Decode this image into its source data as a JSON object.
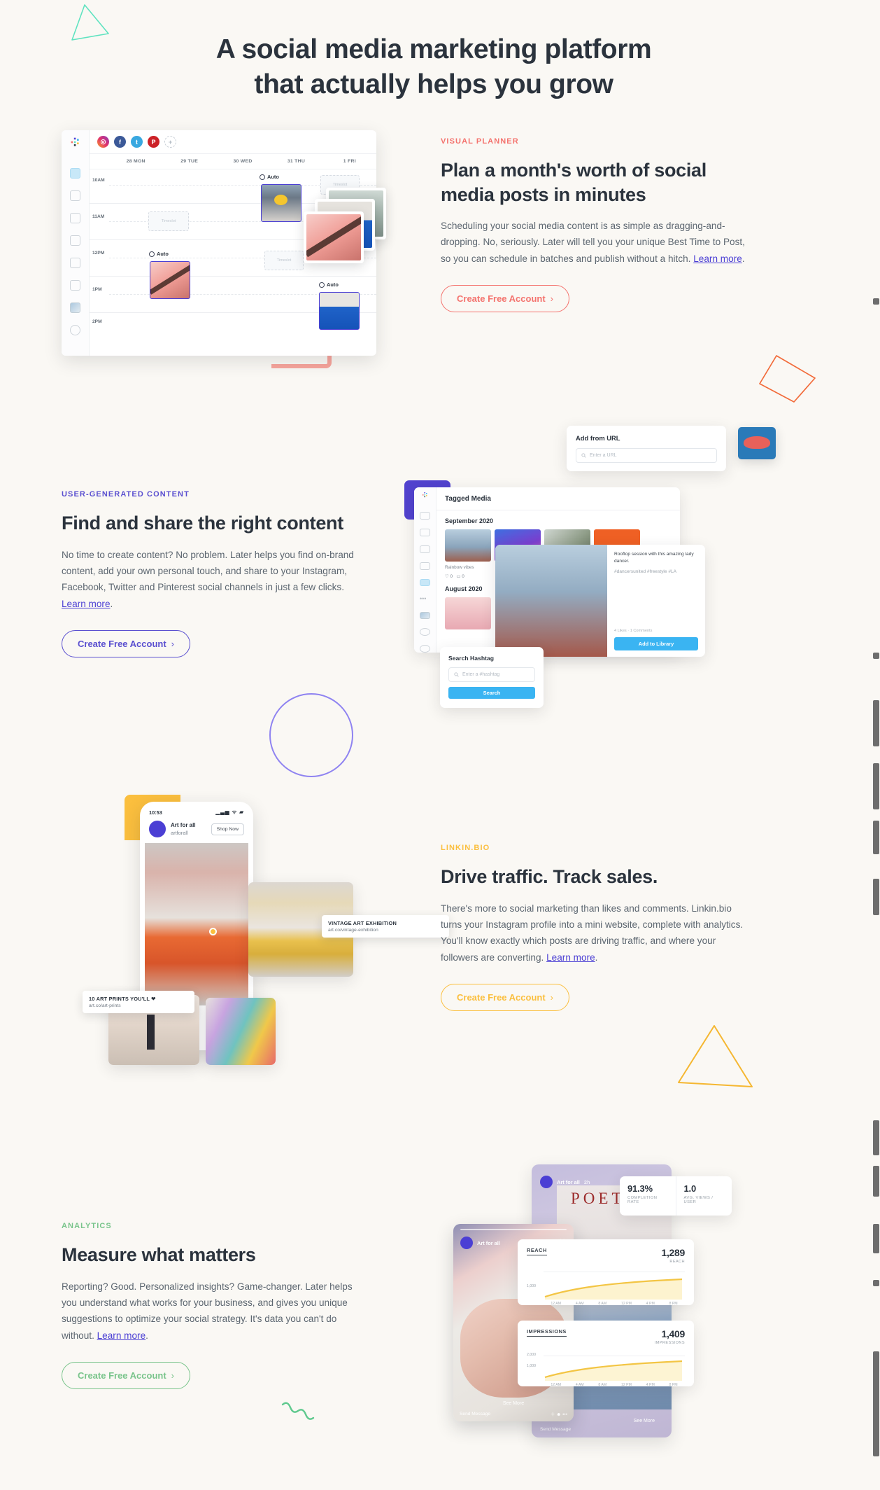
{
  "hero": {
    "line1": "A social media marketing platform",
    "line2": "that actually helps you grow"
  },
  "cta_label": "Create Free Account",
  "cta_chevron": "›",
  "learn_more": "Learn more",
  "colors": {
    "background": "#faf8f4",
    "heading": "#2b333d",
    "body_text": "#5c6670",
    "link": "#4b3fd4",
    "coral": "#f4736e",
    "purple": "#5a4fd0",
    "amber": "#fbbf3e",
    "green": "#79c48b",
    "blue_accent": "#3ab4f2"
  },
  "sections": [
    {
      "eyebrow": "VISUAL PLANNER",
      "heading": "Plan a month's worth of social media posts in minutes",
      "body_before": "Scheduling your social media content is as simple as dragging-and-dropping. No, seriously. Later will tell you your unique Best Time to Post, so you can schedule in batches and publish without a hitch. ",
      "body_after": ".",
      "accent": "coral"
    },
    {
      "eyebrow": "USER-GENERATED CONTENT",
      "heading": "Find and share the right content",
      "body_before": "No time to create content? No problem. Later helps you find on-brand content, add your own personal touch, and share to your Instagram, Facebook, Twitter and Pinterest social channels in just a few clicks. ",
      "body_after": ".",
      "accent": "purple"
    },
    {
      "eyebrow": "LINKIN.BIO",
      "heading": "Drive traffic. Track sales.",
      "body_before": "There's more to social marketing than likes and comments. Linkin.bio turns your Instagram profile into a mini website, complete with analytics. You'll know exactly which posts are driving traffic, and where your followers are converting. ",
      "body_after": ".",
      "accent": "amber"
    },
    {
      "eyebrow": "ANALYTICS",
      "heading": "Measure what matters",
      "body_before": "Reporting? Good. Personalized insights? Game-changer. Later helps you understand what works for your business, and gives you unique suggestions to optimize your social strategy. It's data you can't do without. ",
      "body_after": ".",
      "accent": "green"
    }
  ],
  "calendar_mock": {
    "days": [
      "28 MON",
      "29 TUE",
      "30 WED",
      "31 THU",
      "1 FRI"
    ],
    "times": [
      "10AM",
      "11AM",
      "12PM",
      "1PM",
      "2PM"
    ],
    "auto_label": "Auto",
    "timeslot_label": "Timeslot",
    "social_accounts": [
      "instagram",
      "facebook",
      "twitter",
      "pinterest"
    ],
    "add_account": "+"
  },
  "ugc_mock": {
    "add_from_url_title": "Add from URL",
    "url_placeholder": "Enter a URL",
    "tagged_media_title": "Tagged Media",
    "month_1": "September 2020",
    "month_2": "August 2020",
    "thumb_caption": "Rainbow vibes",
    "thumb_likes": "0",
    "thumb_comments": "0",
    "detail_caption": "Rooftop session with this amazing lady dancer.",
    "detail_tags": "#dancersunited #freestyle #LA",
    "detail_meta": "4 Likes  ·  1 Comments",
    "add_to_library": "Add to Library",
    "search_hashtag_title": "Search Hashtag",
    "hashtag_placeholder": "Enter a #hashtag",
    "search_button": "Search"
  },
  "linkinbio_mock": {
    "status_time": "10:53",
    "profile_name": "Art for all",
    "profile_handle": "artforall",
    "shop_now": "Shop Now",
    "link_1_title": "VINTAGE ART EXHIBITION",
    "link_1_url": "art.co/vintage-exhibition",
    "link_2_title": "10 ART PRINTS YOU'LL ❤",
    "link_2_url": "art.co/art-prints"
  },
  "analytics_mock": {
    "story_name": "Art for all",
    "story_time": "2h",
    "send_message": "Send Message",
    "see_more": "See More",
    "poetry_word": "POETRY",
    "stats": [
      {
        "value": "91.3%",
        "label": "COMPLETION RATE"
      },
      {
        "value": "1.0",
        "label": "AVG. VIEWS / USER"
      }
    ],
    "charts": [
      {
        "title": "REACH",
        "value": "1,289",
        "sublabel": "REACH",
        "yticks": [
          "1,000"
        ],
        "xticks": [
          "12 AM",
          "4 AM",
          "8 AM",
          "12 PM",
          "4 PM",
          "8 PM"
        ]
      },
      {
        "title": "IMPRESSIONS",
        "value": "1,409",
        "sublabel": "IMPRESSIONS",
        "yticks": [
          "2,000",
          "1,000"
        ],
        "xticks": [
          "12 AM",
          "4 AM",
          "8 AM",
          "12 PM",
          "4 PM",
          "8 PM"
        ]
      }
    ]
  }
}
